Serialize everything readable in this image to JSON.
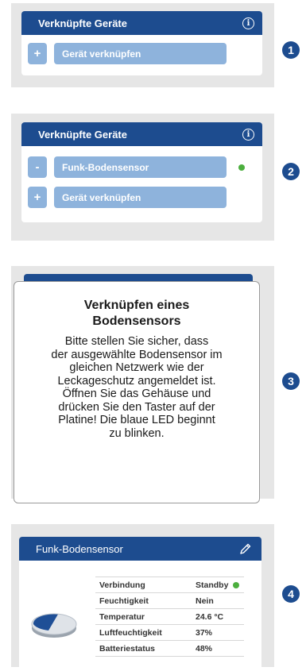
{
  "step1": {
    "header": "Verknüpfte Geräte",
    "add_label": "Gerät verknüpfen",
    "plus": "+",
    "badge": "1"
  },
  "step2": {
    "header": "Verknüpfte Geräte",
    "device_label": "Funk-Bodensensor",
    "minus": "-",
    "add_label": "Gerät verknüpfen",
    "plus": "+",
    "badge": "2"
  },
  "step3": {
    "title_line1": "Verknüpfen eines",
    "title_line2": "Bodensensors",
    "body_lines": [
      "Bitte stellen Sie sicher, dass",
      "der ausgewählte Bodensensor im",
      "gleichen Netzwerk wie der",
      "Leckageschutz angemeldet ist.",
      "Öffnen Sie das Gehäuse und",
      "drücken Sie den Taster auf der",
      "Platine! Die blaue LED beginnt",
      "zu blinken."
    ],
    "badge": "3"
  },
  "step4": {
    "header": "Funk-Bodensensor",
    "rows": [
      {
        "label": "Verbindung",
        "value": "Standby"
      },
      {
        "label": "Feuchtigkeit",
        "value": "Nein"
      },
      {
        "label": "Temperatur",
        "value": "24.6 °C"
      },
      {
        "label": "Luftfeuchtigkeit",
        "value": "37%"
      },
      {
        "label": "Batteriestatus",
        "value": "48%"
      }
    ],
    "badge": "4"
  },
  "info_icon_glyph": "i",
  "colors": {
    "header_blue": "#1d4c8f",
    "button_blue": "#8eb3dc",
    "status_green": "#4caf3e",
    "panel_grey": "#e6e6e6"
  }
}
